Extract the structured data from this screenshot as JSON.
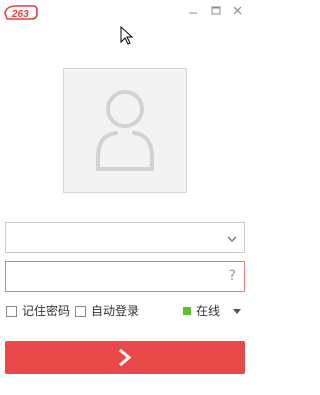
{
  "app": {
    "logo_text": "263",
    "brand_color": "#e83f3f"
  },
  "window": {
    "minimize_icon": "minimize-icon",
    "maximize_icon": "maximize-icon",
    "close_icon": "close-icon"
  },
  "avatar": {
    "icon": "user-silhouette-icon"
  },
  "login_form": {
    "account": {
      "value": "",
      "placeholder": "",
      "dropdown_icon": "chevron-down-icon"
    },
    "password": {
      "value": "",
      "placeholder": "",
      "help_label": "?"
    },
    "remember_password": {
      "label": "记住密码",
      "checked": false
    },
    "auto_login": {
      "label": "自动登录",
      "checked": false
    },
    "status": {
      "label": "在线",
      "color": "#5ec32b",
      "caret_icon": "caret-down-icon"
    },
    "submit": {
      "icon": "arrow-right-icon",
      "color": "#e84a4a"
    }
  }
}
